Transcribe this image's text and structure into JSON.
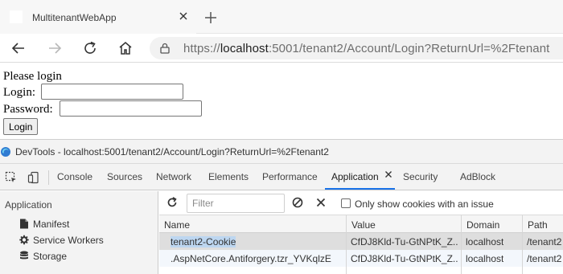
{
  "browser": {
    "tab_title": "MultitenantWebApp",
    "url_scheme": "https://",
    "url_host": "localhost",
    "url_rest": ":5001/tenant2/Account/Login?ReturnUrl=%2Ftenant"
  },
  "page": {
    "title": "Please login",
    "login_label": "Login:",
    "password_label": "Password:",
    "login_value": "",
    "password_value": "",
    "login_button": "Login"
  },
  "devtools": {
    "window_title": "DevTools - localhost:5001/tenant2/Account/Login?ReturnUrl=%2Ftenant2",
    "tabs": [
      "Console",
      "Sources",
      "Network",
      "Elements",
      "Performance",
      "Application",
      "Security",
      "AdBlock"
    ],
    "active_tab": "Application",
    "sidebar": {
      "heading": "Application",
      "items": [
        {
          "label": "Manifest",
          "icon": "file-icon"
        },
        {
          "label": "Service Workers",
          "icon": "gear-icon"
        },
        {
          "label": "Storage",
          "icon": "database-icon"
        }
      ]
    },
    "toolbar": {
      "filter_placeholder": "Filter",
      "filter_value": "",
      "only_issues_label": "Only show cookies with an issue",
      "only_issues_checked": false
    },
    "cookies": {
      "columns": [
        "Name",
        "Value",
        "Domain",
        "Path"
      ],
      "rows": [
        {
          "name": "tenant2-Cookie",
          "value": "CfDJ8Kld-Tu-GtNPtK_Z...",
          "domain": "localhost",
          "path": "/tenant2"
        },
        {
          "name": ".AspNetCore.Antiforgery.tzr_YVKqlzE",
          "value": "CfDJ8Kld-Tu-GtNPtK_Z...",
          "domain": "localhost",
          "path": "/tenant2"
        }
      ]
    }
  },
  "colors": {
    "active_tab_underline": "#1a73e8",
    "selected_row": "#dedede",
    "name_highlight": "#bdd6f0"
  }
}
